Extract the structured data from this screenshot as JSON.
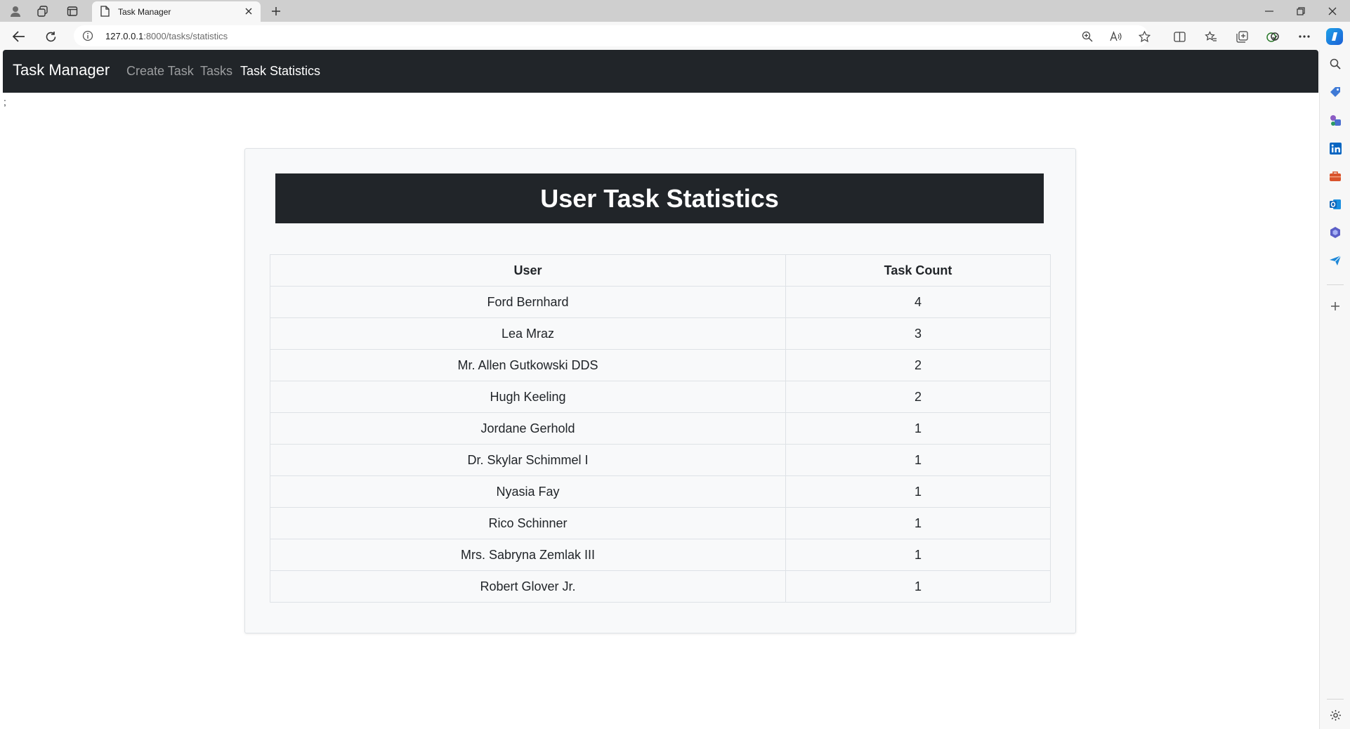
{
  "browser": {
    "tab_title": "Task Manager",
    "url_host": "127.0.0.1",
    "url_rest": ":8000/tasks/statistics"
  },
  "navbar": {
    "brand": "Task Manager",
    "links": [
      {
        "label": "Create Task",
        "active": false
      },
      {
        "label": "Tasks",
        "active": false
      },
      {
        "label": "Task Statistics",
        "active": true
      }
    ]
  },
  "page": {
    "stray_text": ";",
    "title": "User Task Statistics"
  },
  "table": {
    "headers": [
      "User",
      "Task Count"
    ],
    "rows": [
      {
        "user": "Ford Bernhard",
        "count": "4"
      },
      {
        "user": "Lea Mraz",
        "count": "3"
      },
      {
        "user": "Mr. Allen Gutkowski DDS",
        "count": "2"
      },
      {
        "user": "Hugh Keeling",
        "count": "2"
      },
      {
        "user": "Jordane Gerhold",
        "count": "1"
      },
      {
        "user": "Dr. Skylar Schimmel I",
        "count": "1"
      },
      {
        "user": "Nyasia Fay",
        "count": "1"
      },
      {
        "user": "Rico Schinner",
        "count": "1"
      },
      {
        "user": "Mrs. Sabryna Zemlak III",
        "count": "1"
      },
      {
        "user": "Robert Glover Jr.",
        "count": "1"
      }
    ]
  },
  "colors": {
    "navbar_bg": "#212529",
    "card_bg": "#f8f9fa",
    "border": "#dee2e6"
  }
}
